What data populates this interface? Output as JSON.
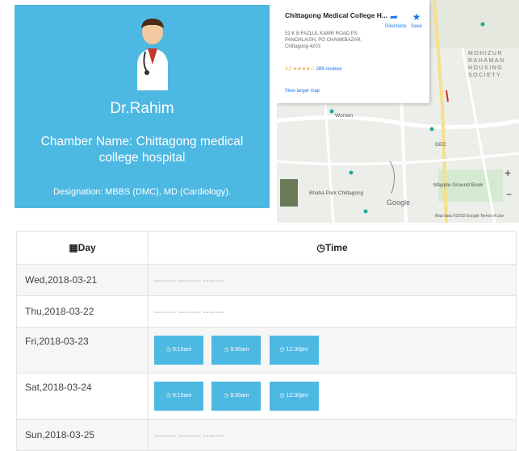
{
  "doctor": {
    "name": "Dr.Rahim",
    "chamber": "Chamber Name: Chittagong medical college hospital",
    "designation": "Designation: MBBS (DMC), MD (Cardiology)."
  },
  "map": {
    "place_name": "Chittagong Medical College H...",
    "address": "52 K B FAZLUL KABIR ROAD PS PANCHLAISH, PO CHAWKBAZAR, Chittagong 4203",
    "rating": "4.2",
    "stars": "★★★★☆",
    "reviews": "289 reviews",
    "larger_map": "View larger map",
    "directions": "Directions",
    "save": "Save",
    "labels": [
      "Women",
      "GEC",
      "Bhaha Park Chittagong",
      "Mapple Ground Book"
    ],
    "area": "MOHIZUR RAHAMAN HOUSING SOCIETY",
    "google": "Google",
    "attribution": "Map data ©2018 Google   Terms of Use"
  },
  "schedule": {
    "day_header": "Day",
    "time_header": "Time",
    "rows": [
      {
        "day": "Wed,2018-03-21",
        "dash": "------- ------- -------"
      },
      {
        "day": "Thu,2018-03-22",
        "dash": "------- ------- -------"
      },
      {
        "day": "Fri,2018-03-23",
        "slots": [
          "9:15am",
          "9:30am",
          "12:30pm"
        ]
      },
      {
        "day": "Sat,2018-03-24",
        "slots": [
          "9:15am",
          "9:30am",
          "12:30pm"
        ]
      },
      {
        "day": "Sun,2018-03-25",
        "dash": "------- ------- -------"
      }
    ]
  },
  "colors": {
    "accent": "#4db8e2",
    "table_alt": "#f6f6f6"
  },
  "icons": {
    "calendar": "calendar-icon",
    "clock": "clock-icon",
    "time_slot": "clock-icon"
  }
}
